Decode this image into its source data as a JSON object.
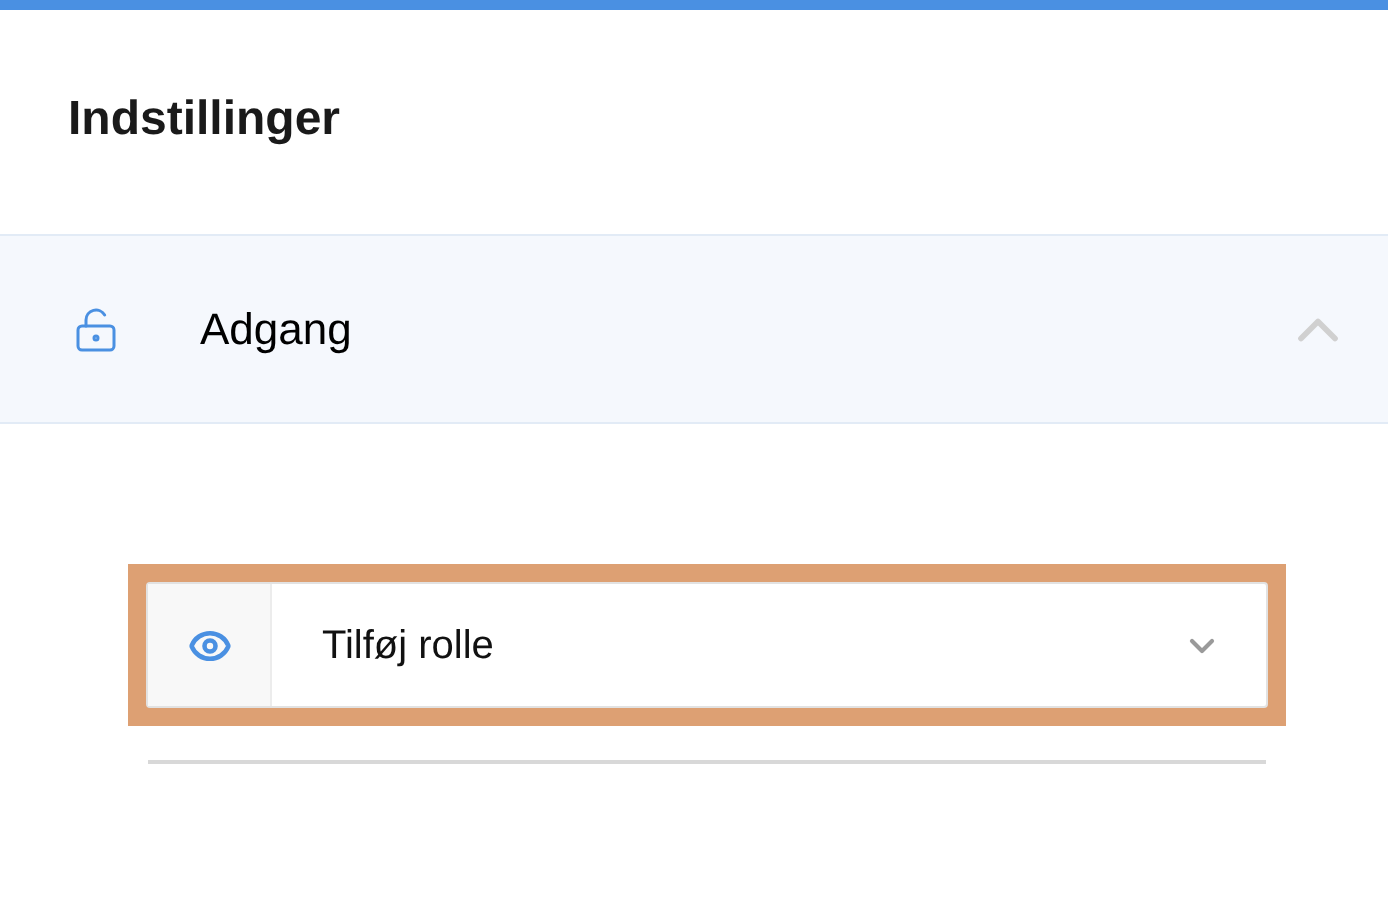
{
  "title": "Indstillinger",
  "section": {
    "label": "Adgang",
    "expanded": true
  },
  "role_select": {
    "placeholder": "Tilføj rolle",
    "highlighted": true
  }
}
